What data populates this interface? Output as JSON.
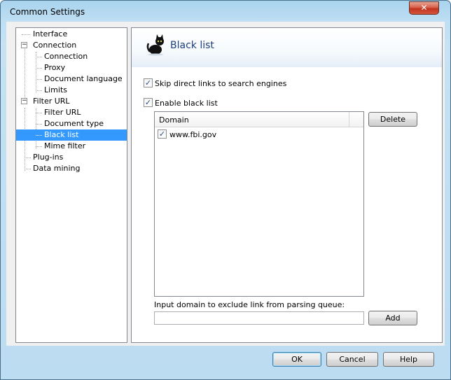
{
  "window": {
    "title": "Common Settings",
    "close_symbol": "✕"
  },
  "tree": {
    "items": [
      {
        "label": "Interface"
      },
      {
        "label": "Connection",
        "expander": "−"
      },
      {
        "label": "Connection"
      },
      {
        "label": "Proxy"
      },
      {
        "label": "Document language"
      },
      {
        "label": "Limits"
      },
      {
        "label": "Filter URL",
        "expander": "−"
      },
      {
        "label": "Filter URL"
      },
      {
        "label": "Document type"
      },
      {
        "label": "Black list"
      },
      {
        "label": "Mime filter"
      },
      {
        "label": "Plug-ins"
      },
      {
        "label": "Data mining"
      }
    ]
  },
  "panel": {
    "title": "Black list",
    "icon": "black-cat-icon",
    "skip_links": {
      "label": "Skip direct links to search engines",
      "checked": true
    },
    "enable_black_list": {
      "label": "Enable black list",
      "checked": true
    },
    "list": {
      "column_header": "Domain",
      "rows": [
        {
          "domain": "www.fbi.gov",
          "checked": true
        }
      ]
    },
    "delete_label": "Delete",
    "input_label": "Input domain to exclude link from parsing queue:",
    "input_value": "",
    "add_label": "Add"
  },
  "footer": {
    "ok_label": "OK",
    "cancel_label": "Cancel",
    "help_label": "Help"
  },
  "check_mark": "✓",
  "colors": {
    "selection": "#3399ff",
    "title_blue": "#1e3f7a"
  }
}
